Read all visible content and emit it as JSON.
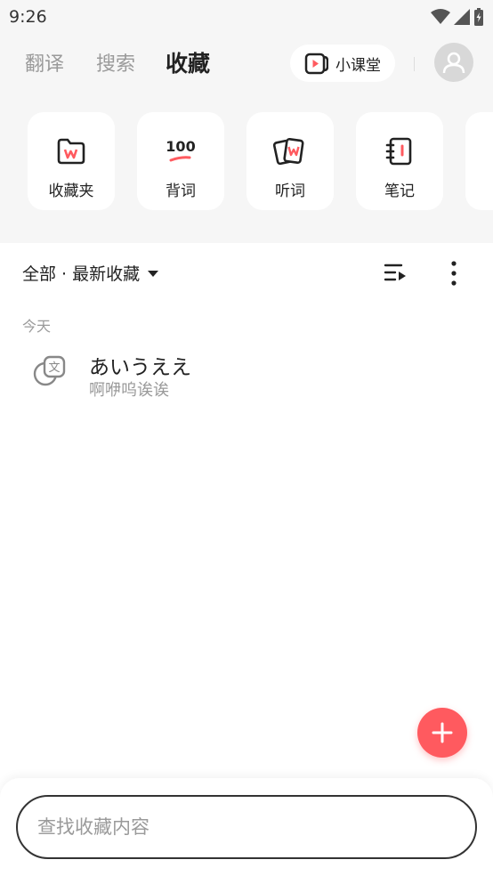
{
  "status_bar": {
    "time": "9:26"
  },
  "header": {
    "tabs": [
      {
        "label": "翻译",
        "active": false
      },
      {
        "label": "搜索",
        "active": false
      },
      {
        "label": "收藏",
        "active": true
      }
    ],
    "classroom_label": "小课堂"
  },
  "shortcuts": [
    {
      "label": "收藏夹",
      "icon": "favorites-folder-icon"
    },
    {
      "label": "背词",
      "icon": "memorize-100-icon"
    },
    {
      "label": "听词",
      "icon": "listen-cards-icon"
    },
    {
      "label": "笔记",
      "icon": "notebook-icon"
    }
  ],
  "filter": {
    "label": "全部 · 最新收藏"
  },
  "list": {
    "section_title": "今天",
    "items": [
      {
        "word": "あいうええ",
        "reading": "啊咿呜诶诶"
      }
    ]
  },
  "search": {
    "placeholder": "查找收藏内容"
  },
  "colors": {
    "accent": "#ff5a5f",
    "background": "#f6f6f6"
  }
}
